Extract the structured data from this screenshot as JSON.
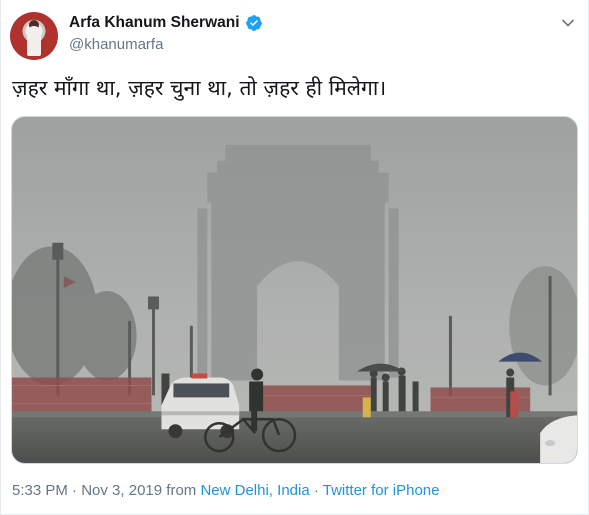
{
  "author": {
    "name": "Arfa Khanum Sherwani",
    "handle": "@khanumarfa",
    "verified": true,
    "avatar_icon": "avatar-woman-icon"
  },
  "tweet": {
    "text": "ज़हर माँगा था, ज़हर चुना था, तो ज़हर ही मिलेगा।"
  },
  "menu_icon": "chevron-down-icon",
  "meta": {
    "time": "5:33 PM",
    "separator": "·",
    "date": "Nov 3, 2019",
    "from_label": "from",
    "location": "New Delhi, India",
    "source": "Twitter for iPhone"
  },
  "colors": {
    "link": "#1b95e0",
    "verified": "#1da1f2",
    "secondary_text": "#657786"
  }
}
